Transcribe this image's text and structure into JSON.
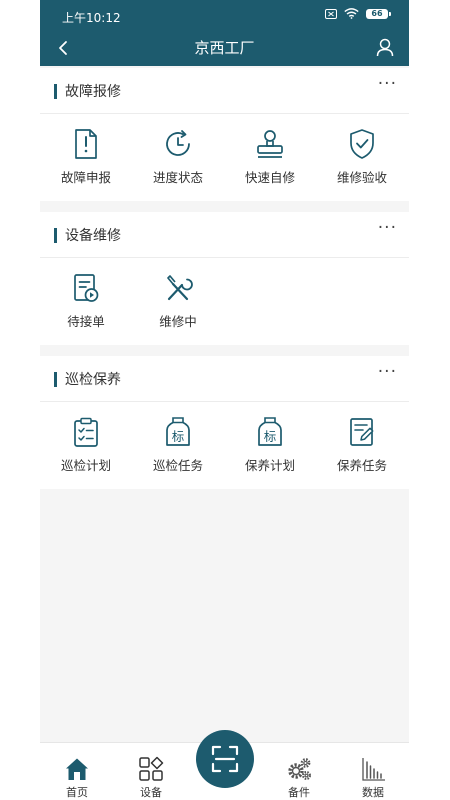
{
  "status_bar": {
    "time": "上午10:12",
    "battery": "66"
  },
  "header": {
    "title": "京西工厂"
  },
  "sections": [
    {
      "title": "故障报修",
      "more": "···",
      "items": [
        "故障申报",
        "进度状态",
        "快速自修",
        "维修验收"
      ]
    },
    {
      "title": "设备维修",
      "more": "···",
      "items": [
        "待接单",
        "维修中"
      ]
    },
    {
      "title": "巡检保养",
      "more": "···",
      "items": [
        "巡检计划",
        "巡检任务",
        "保养计划",
        "保养任务"
      ]
    }
  ],
  "tabbar": {
    "home": "首页",
    "devices": "设备",
    "parts": "备件",
    "data": "数据"
  },
  "icon_char": {
    "tag": "标"
  },
  "colors": {
    "primary": "#1d5b6e",
    "background": "#f5f5f5"
  }
}
